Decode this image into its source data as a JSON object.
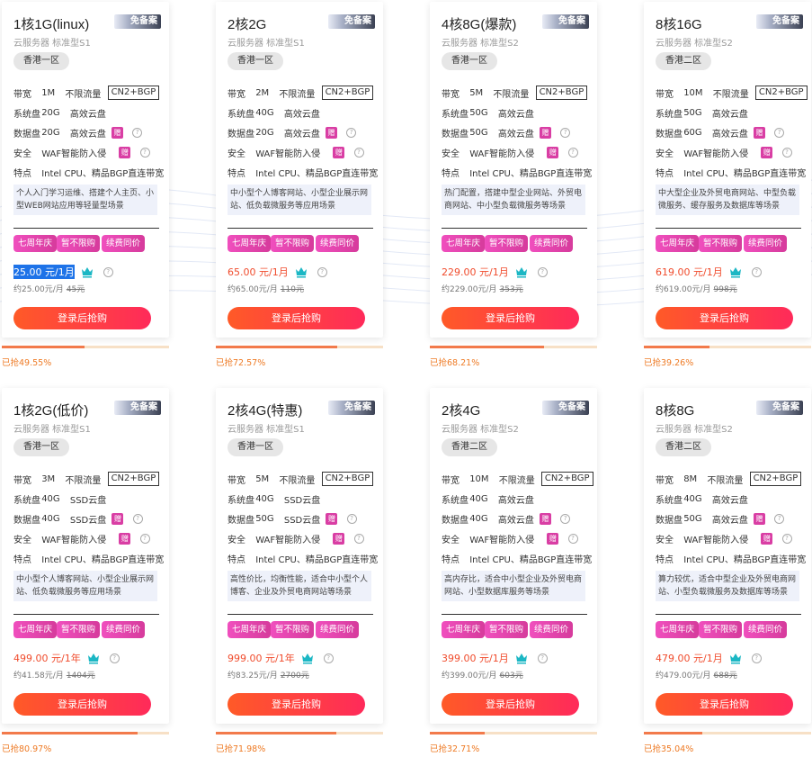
{
  "common": {
    "badge": "免备案",
    "bw_label": "带宽",
    "unlimited": "不限流量",
    "cn2": "CN2+BGP",
    "sysdisk_label": "系统盘",
    "datadisk_label": "数据盘",
    "zeng": "赠",
    "security_label": "安全",
    "security_val": "WAF智能防入侵",
    "feature_label": "特点",
    "feature_val": "Intel CPU、精品BGP直连带宽",
    "tags": [
      "七周年庆",
      "暂不限购",
      "续费同价"
    ],
    "buy_label": "登录后抢购",
    "help": "?"
  },
  "plans": [
    {
      "title": "1核1G(linux)",
      "subtitle": "云服务器 标准型S1",
      "region": "香港一区",
      "bandwidth": "1M",
      "sysdisk_size": "20G",
      "sysdisk_type": "高效云盘",
      "datadisk_size": "20G",
      "datadisk_type": "高效云盘",
      "desc": "个人入门学习运维、搭建个人主页、小型WEB网站应用等轻量型场景",
      "price": "25.00 元/1月",
      "approx": "约25.00元/月",
      "old": "45元",
      "sold": "已抢49.55%",
      "sold_pct": 49.55,
      "price_selected": true
    },
    {
      "title": "2核2G",
      "subtitle": "云服务器 标准型S1",
      "region": "香港一区",
      "bandwidth": "2M",
      "sysdisk_size": "40G",
      "sysdisk_type": "高效云盘",
      "datadisk_size": "20G",
      "datadisk_type": "高效云盘",
      "desc": "中小型个人博客网站、小型企业展示网站、低负载微服务等应用场景",
      "price": "65.00 元/1月",
      "approx": "约65.00元/月",
      "old": "110元",
      "sold": "已抢72.57%",
      "sold_pct": 72.57,
      "price_selected": false
    },
    {
      "title": "4核8G(爆款)",
      "subtitle": "云服务器 标准型S2",
      "region": "香港一区",
      "bandwidth": "5M",
      "sysdisk_size": "50G",
      "sysdisk_type": "高效云盘",
      "datadisk_size": "50G",
      "datadisk_type": "高效云盘",
      "desc": "热门配置，搭建中型企业网站、外贸电商网站、中小型负载微服务等场景",
      "price": "229.00 元/1月",
      "approx": "约229.00元/月",
      "old": "353元",
      "sold": "已抢68.21%",
      "sold_pct": 68.21,
      "price_selected": false
    },
    {
      "title": "8核16G",
      "subtitle": "云服务器 标准型S2",
      "region": "香港二区",
      "bandwidth": "10M",
      "sysdisk_size": "50G",
      "sysdisk_type": "高效云盘",
      "datadisk_size": "60G",
      "datadisk_type": "高效云盘",
      "desc": "中大型企业及外贸电商网站、中型负载微服务、缓存服务及数据库等场景",
      "price": "619.00 元/1月",
      "approx": "约619.00元/月",
      "old": "998元",
      "sold": "已抢39.26%",
      "sold_pct": 39.26,
      "price_selected": false
    },
    {
      "title": "1核2G(低价)",
      "subtitle": "云服务器 标准型S1",
      "region": "香港一区",
      "bandwidth": "3M",
      "sysdisk_size": "40G",
      "sysdisk_type": "SSD云盘",
      "datadisk_size": "40G",
      "datadisk_type": "SSD云盘",
      "desc": "中小型个人博客网站、小型企业展示网站、低负载微服务等应用场景",
      "price": "499.00 元/1年",
      "approx": "约41.58元/月",
      "old": "1404元",
      "sold": "已抢80.97%",
      "sold_pct": 80.97,
      "price_selected": false
    },
    {
      "title": "2核4G(特惠)",
      "subtitle": "云服务器 标准型S1",
      "region": "香港一区",
      "bandwidth": "5M",
      "sysdisk_size": "40G",
      "sysdisk_type": "SSD云盘",
      "datadisk_size": "50G",
      "datadisk_type": "SSD云盘",
      "desc": "高性价比，均衡性能，适合中小型个人博客、企业及外贸电商网站等场景",
      "price": "999.00 元/1年",
      "approx": "约83.25元/月",
      "old": "2700元",
      "sold": "已抢71.98%",
      "sold_pct": 71.98,
      "price_selected": false
    },
    {
      "title": "2核4G",
      "subtitle": "云服务器 标准型S2",
      "region": "香港二区",
      "bandwidth": "10M",
      "sysdisk_size": "40G",
      "sysdisk_type": "高效云盘",
      "datadisk_size": "40G",
      "datadisk_type": "高效云盘",
      "desc": "高内存比，适合中小型企业及外贸电商网站、小型数据库服务等场景",
      "price": "399.00 元/1月",
      "approx": "约399.00元/月",
      "old": "603元",
      "sold": "已抢32.71%",
      "sold_pct": 32.71,
      "price_selected": false
    },
    {
      "title": "8核8G",
      "subtitle": "云服务器 标准型S2",
      "region": "香港二区",
      "bandwidth": "8M",
      "sysdisk_size": "40G",
      "sysdisk_type": "高效云盘",
      "datadisk_size": "50G",
      "datadisk_type": "高效云盘",
      "desc": "算力较优，适合中型企业及外贸电商网站、小型负载微服务及数据库等场景",
      "price": "479.00 元/1月",
      "approx": "约479.00元/月",
      "old": "688元",
      "sold": "已抢35.04%",
      "sold_pct": 35.04,
      "price_selected": false
    }
  ],
  "colors": {
    "price": "#f04c2d",
    "tag": "#e046b0",
    "buy_start": "#ff5a27",
    "buy_end": "#ff2a5a",
    "bar_fill": "#f27a4b",
    "bar_track": "#f7e0c6",
    "sold_text": "#ee7a24",
    "crown": "#1bb7c4"
  }
}
